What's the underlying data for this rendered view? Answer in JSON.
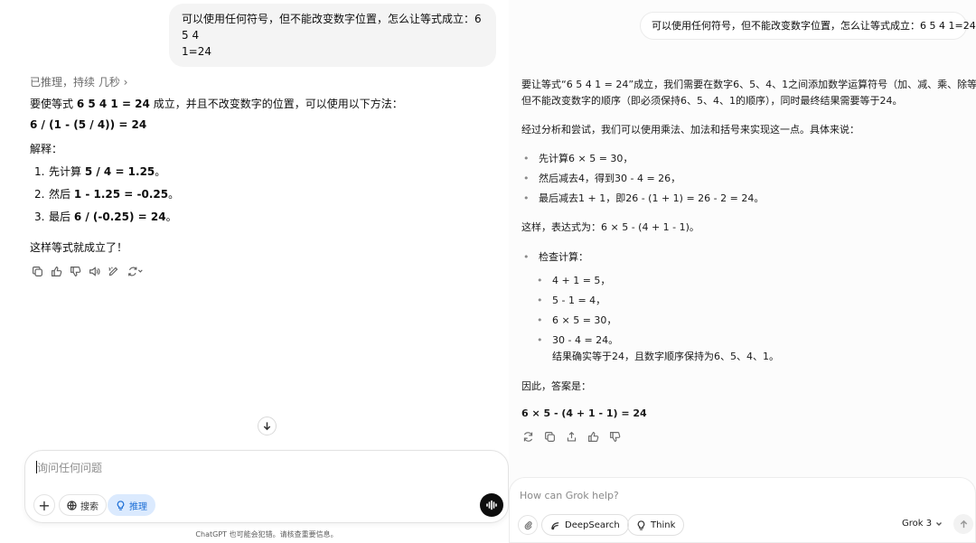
{
  "chatgpt": {
    "user_message_line1": "可以使用任何符号，但不能改变数字位置，怎么让等式成立：6 5 4",
    "user_message_line2": "1=24",
    "reasoning_label": "已推理，持续 几秒 ›",
    "intro_prefix": "要使等式 ",
    "intro_bold": "6 5 4 1 = 24",
    "intro_suffix": " 成立，并且不改变数字的位置，可以使用以下方法：",
    "formula": "6 / (1 - (5 / 4)) = 24",
    "explain_label": "解释：",
    "steps": [
      {
        "num": "1.",
        "prefix": "先计算 ",
        "bold": "5 / 4 = 1.25",
        "suffix": "。"
      },
      {
        "num": "2.",
        "prefix": "然后 ",
        "bold": "1 - 1.25 = -0.25",
        "suffix": "。"
      },
      {
        "num": "3.",
        "prefix": "最后 ",
        "bold": "6 / (-0.25) = 24",
        "suffix": "。"
      }
    ],
    "conclusion": "这样等式就成立了！",
    "input_placeholder": "询问任何问题",
    "search_label": "搜索",
    "reason_label": "推理",
    "disclaimer": "ChatGPT 也可能会犯错。请核查重要信息。"
  },
  "grok": {
    "user_message": "可以使用任何符号，但不能改变数字位置，怎么让等式成立：6 5 4 1=24",
    "para1_line1": "要让等式“6 5 4 1 = 24”成立，我们需要在数字6、5、4、1之间添加数学运算符号（加、减、乘、除等），",
    "para1_line2": "但不能改变数字的顺序（即必须保持6、5、4、1的顺序），同时最终结果需要等于24。",
    "para2": "经过分析和尝试，我们可以使用乘法、加法和括号来实现这一点。具体来说：",
    "bullets": [
      "先计算6 × 5 = 30，",
      "然后减去4，得到30 - 4 = 26，",
      "最后减去1 + 1，即26 - (1 + 1) = 26 - 2 = 24。"
    ],
    "expression_line": "这样，表达式为：6 × 5 - (4 + 1 - 1)。",
    "check_label": "检查计算：",
    "checks": [
      "4 + 1 = 5，",
      "5 - 1 = 4，",
      "6 × 5 = 30，",
      "30 - 4 = 24。"
    ],
    "check_result": "结果确实等于24，且数字顺序保持为6、5、4、1。",
    "answer_label": "因此，答案是：",
    "answer": "6 × 5 - (4 + 1 - 1) = 24",
    "input_placeholder": "How can Grok help?",
    "deepsearch_label": "DeepSearch",
    "think_label": "Think",
    "model_label": "Grok 3"
  }
}
